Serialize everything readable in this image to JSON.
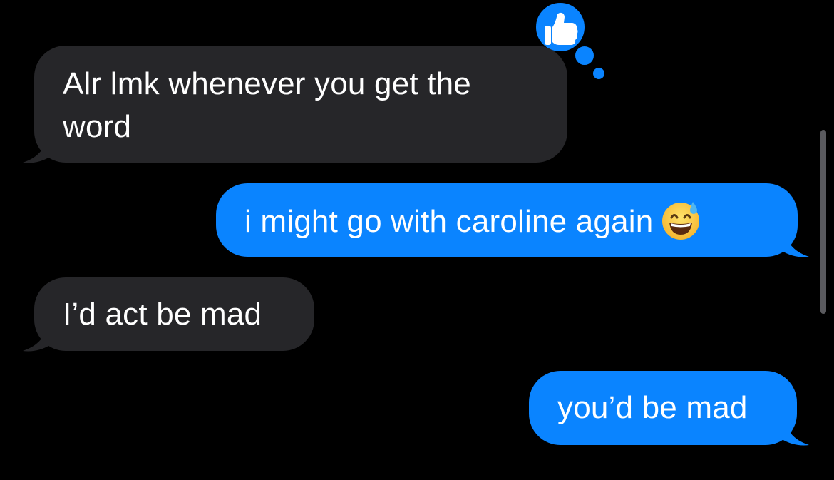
{
  "conversation": {
    "messages": [
      {
        "direction": "received",
        "text": "Alr lmk whenever you get the word"
      },
      {
        "direction": "sent",
        "text": "i might go with caroline again",
        "emoji": "grinning-face-with-sweat"
      },
      {
        "direction": "received",
        "text": "I’d act be mad"
      },
      {
        "direction": "sent",
        "text": "you’d be mad"
      }
    ],
    "tapback": {
      "icon": "thumbs-up-icon",
      "on_message": 0
    }
  },
  "colors": {
    "background": "#000000",
    "received_bubble": "#262629",
    "sent_bubble": "#0A84FF",
    "text": "#FFFFFF"
  }
}
